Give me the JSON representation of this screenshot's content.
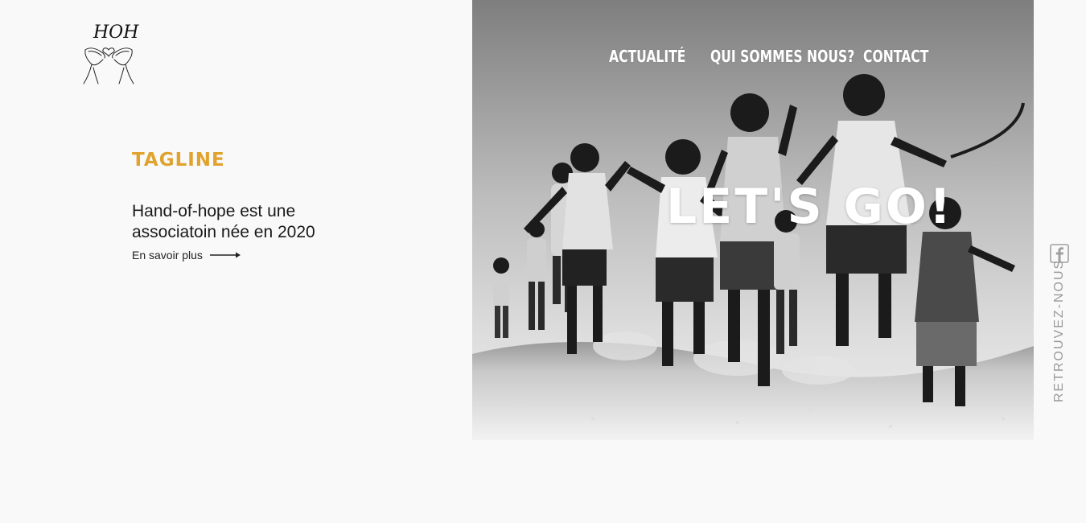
{
  "logo": {
    "text": "HOH",
    "icon": "hands-heart-icon"
  },
  "intro": {
    "tagline": "TAGLINE",
    "description": "Hand-of-hope est une associatoin née en 2020",
    "more_link": "En savoir plus",
    "more_icon": "arrow-right-icon"
  },
  "nav": {
    "items": [
      {
        "label": "ACTUALITÉ"
      },
      {
        "label": "QUI SOMMES NOUS?"
      },
      {
        "label": "CONTACT"
      }
    ]
  },
  "hero": {
    "headline": "LET'S GO!"
  },
  "social": {
    "label": "RETROUVEZ-NOUS",
    "icon": "facebook-icon"
  },
  "colors": {
    "background": "#f9f9f9",
    "accent": "#e0a32e",
    "text": "#1a1a1a",
    "muted": "#9a9a9a",
    "white": "#ffffff"
  }
}
